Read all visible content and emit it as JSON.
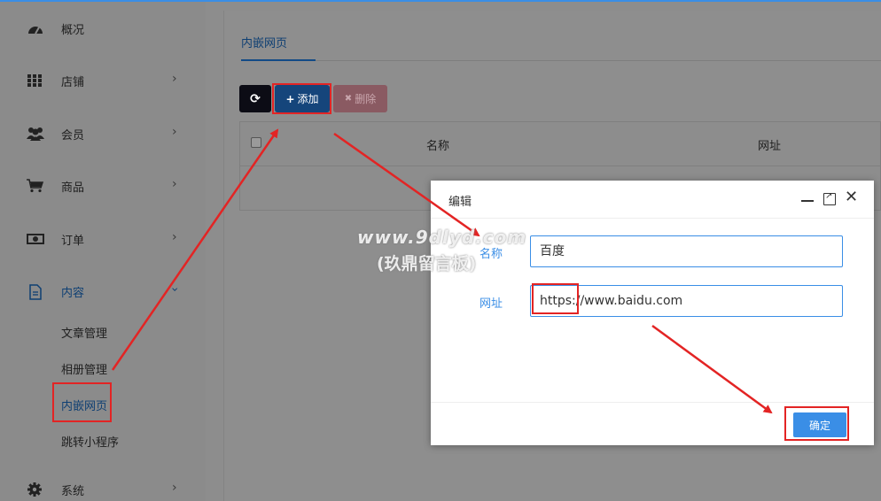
{
  "sidebar": {
    "items": [
      {
        "label": "概况",
        "icon": "dashboard-icon"
      },
      {
        "label": "店铺",
        "icon": "grid-icon"
      },
      {
        "label": "会员",
        "icon": "users-icon"
      },
      {
        "label": "商品",
        "icon": "cart-icon"
      },
      {
        "label": "订单",
        "icon": "money-icon"
      },
      {
        "label": "内容",
        "icon": "document-icon"
      },
      {
        "label": "系统",
        "icon": "gear-icon"
      }
    ],
    "content_sub": [
      "文章管理",
      "相册管理",
      "内嵌网页",
      "跳转小程序"
    ]
  },
  "main": {
    "tab": "内嵌网页",
    "toolbar": {
      "add_label": "添加",
      "delete_label": "删除"
    },
    "table_headers": [
      "名称",
      "网址"
    ]
  },
  "dialog": {
    "title": "编辑",
    "fields": [
      {
        "label": "名称",
        "value": "百度"
      },
      {
        "label": "网址",
        "value": "https://www.baidu.com"
      }
    ],
    "ok_label": "确定"
  },
  "watermark": {
    "line1": "www.9dlyd.com",
    "line2": "(玖鼎留言板)"
  },
  "colors": {
    "accent": "#3a8ee6",
    "annotation": "#e32424",
    "delete": "#e8a0aa"
  }
}
